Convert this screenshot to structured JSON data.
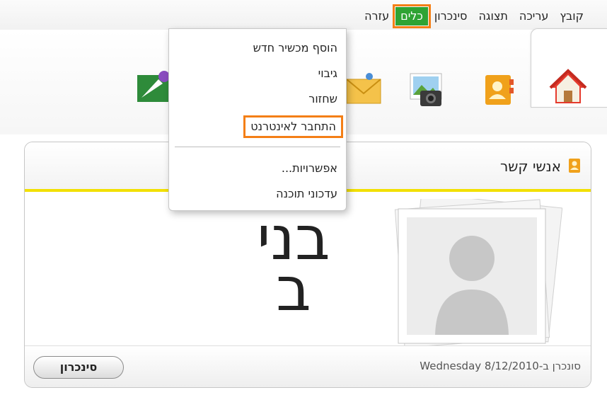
{
  "menu": {
    "items": [
      "קובץ",
      "עריכה",
      "תצוגה",
      "סינכרון",
      "כלים",
      "עזרה"
    ],
    "active": "כלים"
  },
  "tools_menu": {
    "add_device": "הוסף מכשיר חדש",
    "backup": "גיבוי",
    "restore": "שחזור",
    "connect_internet": "התחבר לאינטרנט",
    "options": "אפשרויות...",
    "software_updates": "עדכוני תוכנה"
  },
  "toolbar": {
    "icons": [
      "home-icon",
      "contacts-icon",
      "photos-icon",
      "messages-icon",
      "internet-icon"
    ]
  },
  "contacts_panel": {
    "title": "אנשי קשר",
    "contact_name_line1": "בני",
    "contact_name_line2": "ב",
    "sync_status": "סונכרן ב-Wednesday 8/12/2010",
    "sync_button": "סינכרון"
  },
  "colors": {
    "menu_active_bg": "#2ea334",
    "highlight_border": "#f47f16",
    "panel_accent": "#f2e000"
  }
}
